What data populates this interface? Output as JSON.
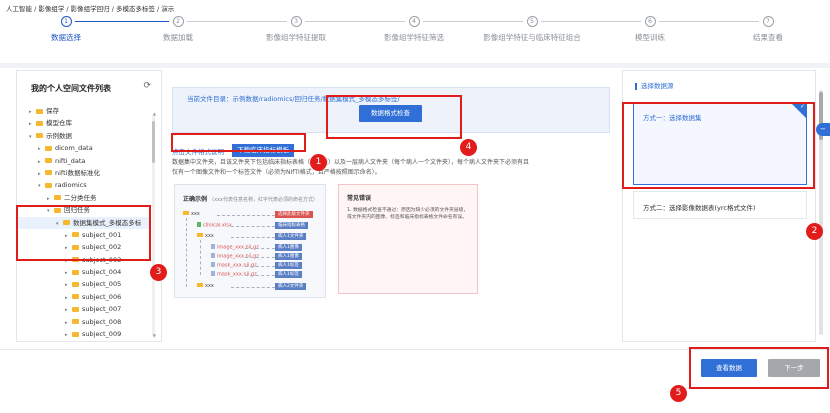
{
  "breadcrumb": "人工智能 / 影像组学 / 影像组学回归 / 多模态多标签 / 演示",
  "steps": [
    {
      "num": "1",
      "label": "数据选择",
      "active": true
    },
    {
      "num": "2",
      "label": "数据加载",
      "active": false
    },
    {
      "num": "3",
      "label": "影像组学特征提取",
      "active": false
    },
    {
      "num": "4",
      "label": "影像组学特征筛选",
      "active": false
    },
    {
      "num": "5",
      "label": "影像组学特征与临床特征组合",
      "active": false
    },
    {
      "num": "6",
      "label": "模型训练",
      "active": false
    },
    {
      "num": "7",
      "label": "结果查看",
      "active": false
    }
  ],
  "left": {
    "title": "我的个人空间文件列表",
    "tree": [
      {
        "label": "保存",
        "depth": 0,
        "arrow": "▸"
      },
      {
        "label": "模型仓库",
        "depth": 0,
        "arrow": "▸"
      },
      {
        "label": "示例数据",
        "depth": 0,
        "arrow": "▾"
      },
      {
        "label": "dicom_data",
        "depth": 1,
        "arrow": "▸"
      },
      {
        "label": "nifti_data",
        "depth": 1,
        "arrow": "▸"
      },
      {
        "label": "nifti数据标准化",
        "depth": 1,
        "arrow": "▸"
      },
      {
        "label": "radiomics",
        "depth": 1,
        "arrow": "▾"
      },
      {
        "label": "二分类任务",
        "depth": 2,
        "arrow": "▸"
      },
      {
        "label": "回归任务",
        "depth": 2,
        "arrow": "▾"
      },
      {
        "label": "数据集模式_多模态多标",
        "depth": 3,
        "arrow": "▾"
      },
      {
        "label": "subject_001",
        "depth": 4,
        "arrow": "▸"
      },
      {
        "label": "subject_002",
        "depth": 4,
        "arrow": "▸"
      },
      {
        "label": "subject_003",
        "depth": 4,
        "arrow": "▸"
      },
      {
        "label": "subject_004",
        "depth": 4,
        "arrow": "▸"
      },
      {
        "label": "subject_005",
        "depth": 4,
        "arrow": "▸"
      },
      {
        "label": "subject_006",
        "depth": 4,
        "arrow": "▸"
      },
      {
        "label": "subject_007",
        "depth": 4,
        "arrow": "▸"
      },
      {
        "label": "subject_008",
        "depth": 4,
        "arrow": "▸"
      },
      {
        "label": "subject_009",
        "depth": 4,
        "arrow": "▸"
      }
    ]
  },
  "middle": {
    "dir_text": "当前文件目录：示例数据/radiomics/回归任务/数据集模式_多模态多标签/",
    "check_button": "数据格式检查",
    "format_link": "点击文件格式说明",
    "download_button": "下载临床指标模板",
    "desc_line1": "数据集中文件夹，且该文件夹下包括临床指标表格（见模板）以及一层病人文件夹（每个病人一个文件夹），每个病人文件夹下必须有且",
    "desc_line2": "仅有一个图像文件和一个标签文件（必须为NIfTI格式，且严格按照图示命名）。",
    "example": {
      "title": "正确示例",
      "title_note": "（xxx代表任意名称，红字代表必须的命名方式）",
      "rows": [
        {
          "text": "xxx",
          "kind": "folder",
          "red": false
        },
        {
          "text": "clinical.xlsx",
          "kind": "file-green",
          "red": true
        },
        {
          "text": "xxx",
          "kind": "folder",
          "red": false
        },
        {
          "text": "image_xxx.nii.gz",
          "kind": "file",
          "red": true
        },
        {
          "text": "image_xxx.nii.gz",
          "kind": "file",
          "red": true
        },
        {
          "text": "mask_xxx.nii.gz",
          "kind": "file",
          "red": true
        },
        {
          "text": "mask_xxx.nii.gz",
          "kind": "file",
          "red": true
        },
        {
          "text": "xxx",
          "kind": "folder",
          "red": false
        }
      ],
      "tags": [
        {
          "text": "选择此级文件夹",
          "color": "#d9534f"
        },
        {
          "text": "临床指标表格",
          "color": "#5b7fc4"
        },
        {
          "text": "病人1文件夹",
          "color": "#5b7fc4"
        },
        {
          "text": "病人1图像",
          "color": "#5b7fc4"
        },
        {
          "text": "病人1图像",
          "color": "#5b7fc4"
        },
        {
          "text": "病人1标签",
          "color": "#5b7fc4"
        },
        {
          "text": "病人1标签",
          "color": "#5b7fc4"
        },
        {
          "text": "病人2文件夹",
          "color": "#5b7fc4"
        }
      ]
    },
    "error": {
      "title": "常见错误",
      "text": "1. 数据格式检查不通过：原因为缺少必须的文件夹层级，或文件夹内的图像、标签和临床指标表格文件命名有误。"
    }
  },
  "right": {
    "title": "选择数据源",
    "option_a": "方式一：选择数据集",
    "option_b": "方式二：选择影像数据表(yrc格式文件)"
  },
  "footer": {
    "view_button": "查看数据",
    "next_button": "下一步"
  },
  "badges": [
    "1",
    "2",
    "3",
    "4",
    "5"
  ],
  "colors": {
    "primary": "#2f6fd6",
    "annotation": "#e21b1b",
    "disabled": "#a4a7ab",
    "folder": "#f5b82e"
  }
}
